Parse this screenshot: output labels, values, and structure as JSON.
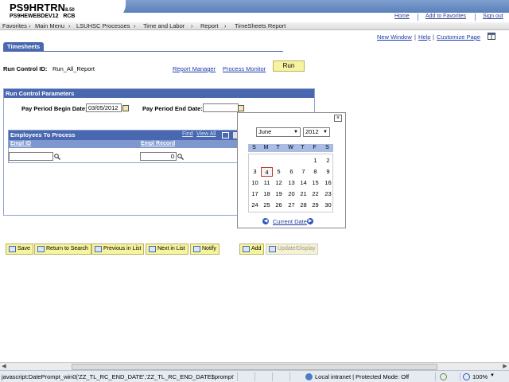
{
  "header": {
    "system_name": "PS9HRTRN",
    "version": "8.50",
    "server": "PS9HEWEBDEV12",
    "user": "RCB",
    "links": [
      "Home",
      "Add to Favorites",
      "Sign out"
    ]
  },
  "menubar": {
    "items": [
      "Favorites",
      "Main Menu",
      "LSUHSC Processes",
      "Time and Labor",
      "Report",
      "TimeSheets Report"
    ],
    "separator": "›"
  },
  "utility_links": [
    "New Window",
    "Help",
    "Customize Page"
  ],
  "tab": {
    "label": "Timesheets"
  },
  "run_control": {
    "label": "Run Control ID:",
    "value": "Run_All_Report",
    "report_manager": "Report Manager",
    "process_monitor": "Process Monitor",
    "run_button": "Run"
  },
  "parameters": {
    "title": "Run Control Parameters",
    "begin_label": "Pay Period Begin Date:",
    "begin_value": "03/05/2012",
    "end_label": "Pay Period End Date:",
    "end_value": ""
  },
  "employees": {
    "title": "Employees To Process",
    "find_link": "Find",
    "view_all_link": "View All",
    "columns": [
      "Empl ID",
      "Empl Record"
    ],
    "row": {
      "empl_id": "",
      "empl_record": "0"
    }
  },
  "calendar": {
    "month": "June",
    "year": "2012",
    "days_of_week": [
      "S",
      "M",
      "T",
      "W",
      "T",
      "F",
      "S"
    ],
    "weeks": [
      [
        "",
        "",
        "",
        "",
        "",
        "1",
        "2"
      ],
      [
        "3",
        "4",
        "5",
        "6",
        "7",
        "8",
        "9"
      ],
      [
        "10",
        "11",
        "12",
        "13",
        "14",
        "15",
        "16"
      ],
      [
        "17",
        "18",
        "19",
        "20",
        "21",
        "22",
        "23"
      ],
      [
        "24",
        "25",
        "26",
        "27",
        "28",
        "29",
        "30"
      ]
    ],
    "today": "4",
    "current_date_link": "Current Date",
    "close": "×"
  },
  "toolbar": {
    "save": "Save",
    "return_to_search": "Return to Search",
    "previous_in_list": "Previous in List",
    "next_in_list": "Next in List",
    "notify": "Notify",
    "add": "Add",
    "update_display": "Update/Display"
  },
  "statusbar": {
    "url": "javascript:DatePrompt_win0('ZZ_TL_RC_END_DATE','ZZ_TL_RC_END_DATE$prompt','450",
    "zone": "Local intranet | Protected Mode: Off",
    "zoom": "100%"
  }
}
